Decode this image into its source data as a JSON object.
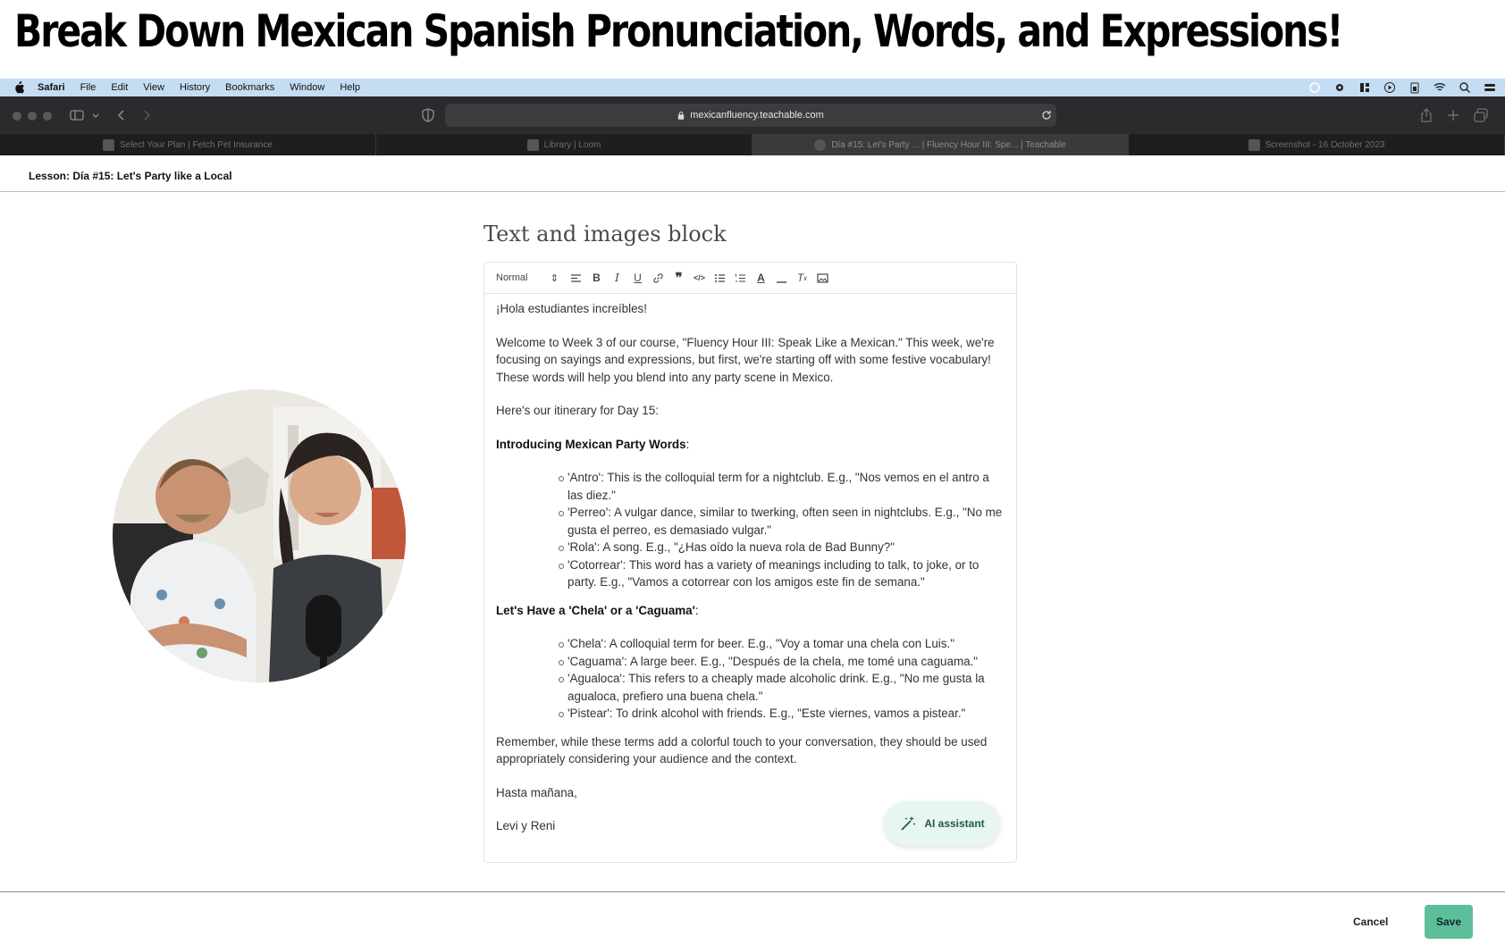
{
  "banner": {
    "title": "Break Down Mexican Spanish Pronunciation, Words, and Expressions!"
  },
  "menubar": {
    "app": "Safari",
    "items": [
      "File",
      "Edit",
      "View",
      "History",
      "Bookmarks",
      "Window",
      "Help"
    ]
  },
  "browser": {
    "url": "mexicanfluency.teachable.com",
    "tabs": [
      {
        "label": "Select Your Plan | Fetch Pet Insurance"
      },
      {
        "label": "Library | Loom"
      },
      {
        "label": "Día #15: Let's Party ... | Fluency Hour III: Spe... | Teachable"
      },
      {
        "label": "Screenshot - 16 October 2023"
      }
    ]
  },
  "lesson": {
    "title": "Lesson: Día #15: Let's Party like a Local"
  },
  "block": {
    "title": "Text and images block"
  },
  "editor": {
    "format": "Normal",
    "greeting": "¡Hola estudiantes increíbles!",
    "intro": "Welcome to Week 3 of our course, \"Fluency Hour III: Speak Like a Mexican.\" This week, we're focusing on sayings and expressions, but first, we're starting off with some festive vocabulary! These words will help you blend into any party scene in Mexico.",
    "itinerary": "Here's our itinerary for Day 15:",
    "section1": {
      "heading": "Introducing Mexican Party Words",
      "suffix": ":"
    },
    "party_words": [
      "'Antro': This is the colloquial term for a nightclub. E.g., \"Nos vemos en el antro a las diez.\"",
      "'Perreo': A vulgar dance, similar to twerking, often seen in nightclubs. E.g., \"No me gusta el perreo, es demasiado vulgar.\"",
      "'Rola': A song. E.g., \"¿Has oído la nueva rola de Bad Bunny?\"",
      "'Cotorrear': This word has a variety of meanings including to talk, to joke, or to party. E.g., \"Vamos a cotorrear con los amigos este fin de semana.\""
    ],
    "section2": {
      "heading": "Let's Have a 'Chela' or a 'Caguama'",
      "suffix": ":"
    },
    "drink_words": [
      "'Chela': A colloquial term for beer. E.g., \"Voy a tomar una chela con Luis.\"",
      "'Caguama': A large beer. E.g., \"Después de la chela, me tomé una caguama.\"",
      "'Agualoca': This refers to a cheaply made alcoholic drink. E.g., \"No me gusta la agualoca, prefiero una buena chela.\"",
      "'Pistear': To drink alcohol with friends. E.g., \"Este viernes, vamos a pistear.\""
    ],
    "reminder": "Remember, while these terms add a colorful touch to your conversation, they should be used appropriately considering your audience and the context.",
    "signoff": "Hasta mañana,",
    "signature": "Levi y Reni"
  },
  "ai_assistant": {
    "label": "AI assistant"
  },
  "footer": {
    "cancel_label": "Cancel",
    "save_label": "Save"
  },
  "colors": {
    "save": "#5cbf99",
    "ai_bg": "#e8f6f0",
    "menubar": "#c5ddf2",
    "toolbar": "#2b2b2d"
  }
}
